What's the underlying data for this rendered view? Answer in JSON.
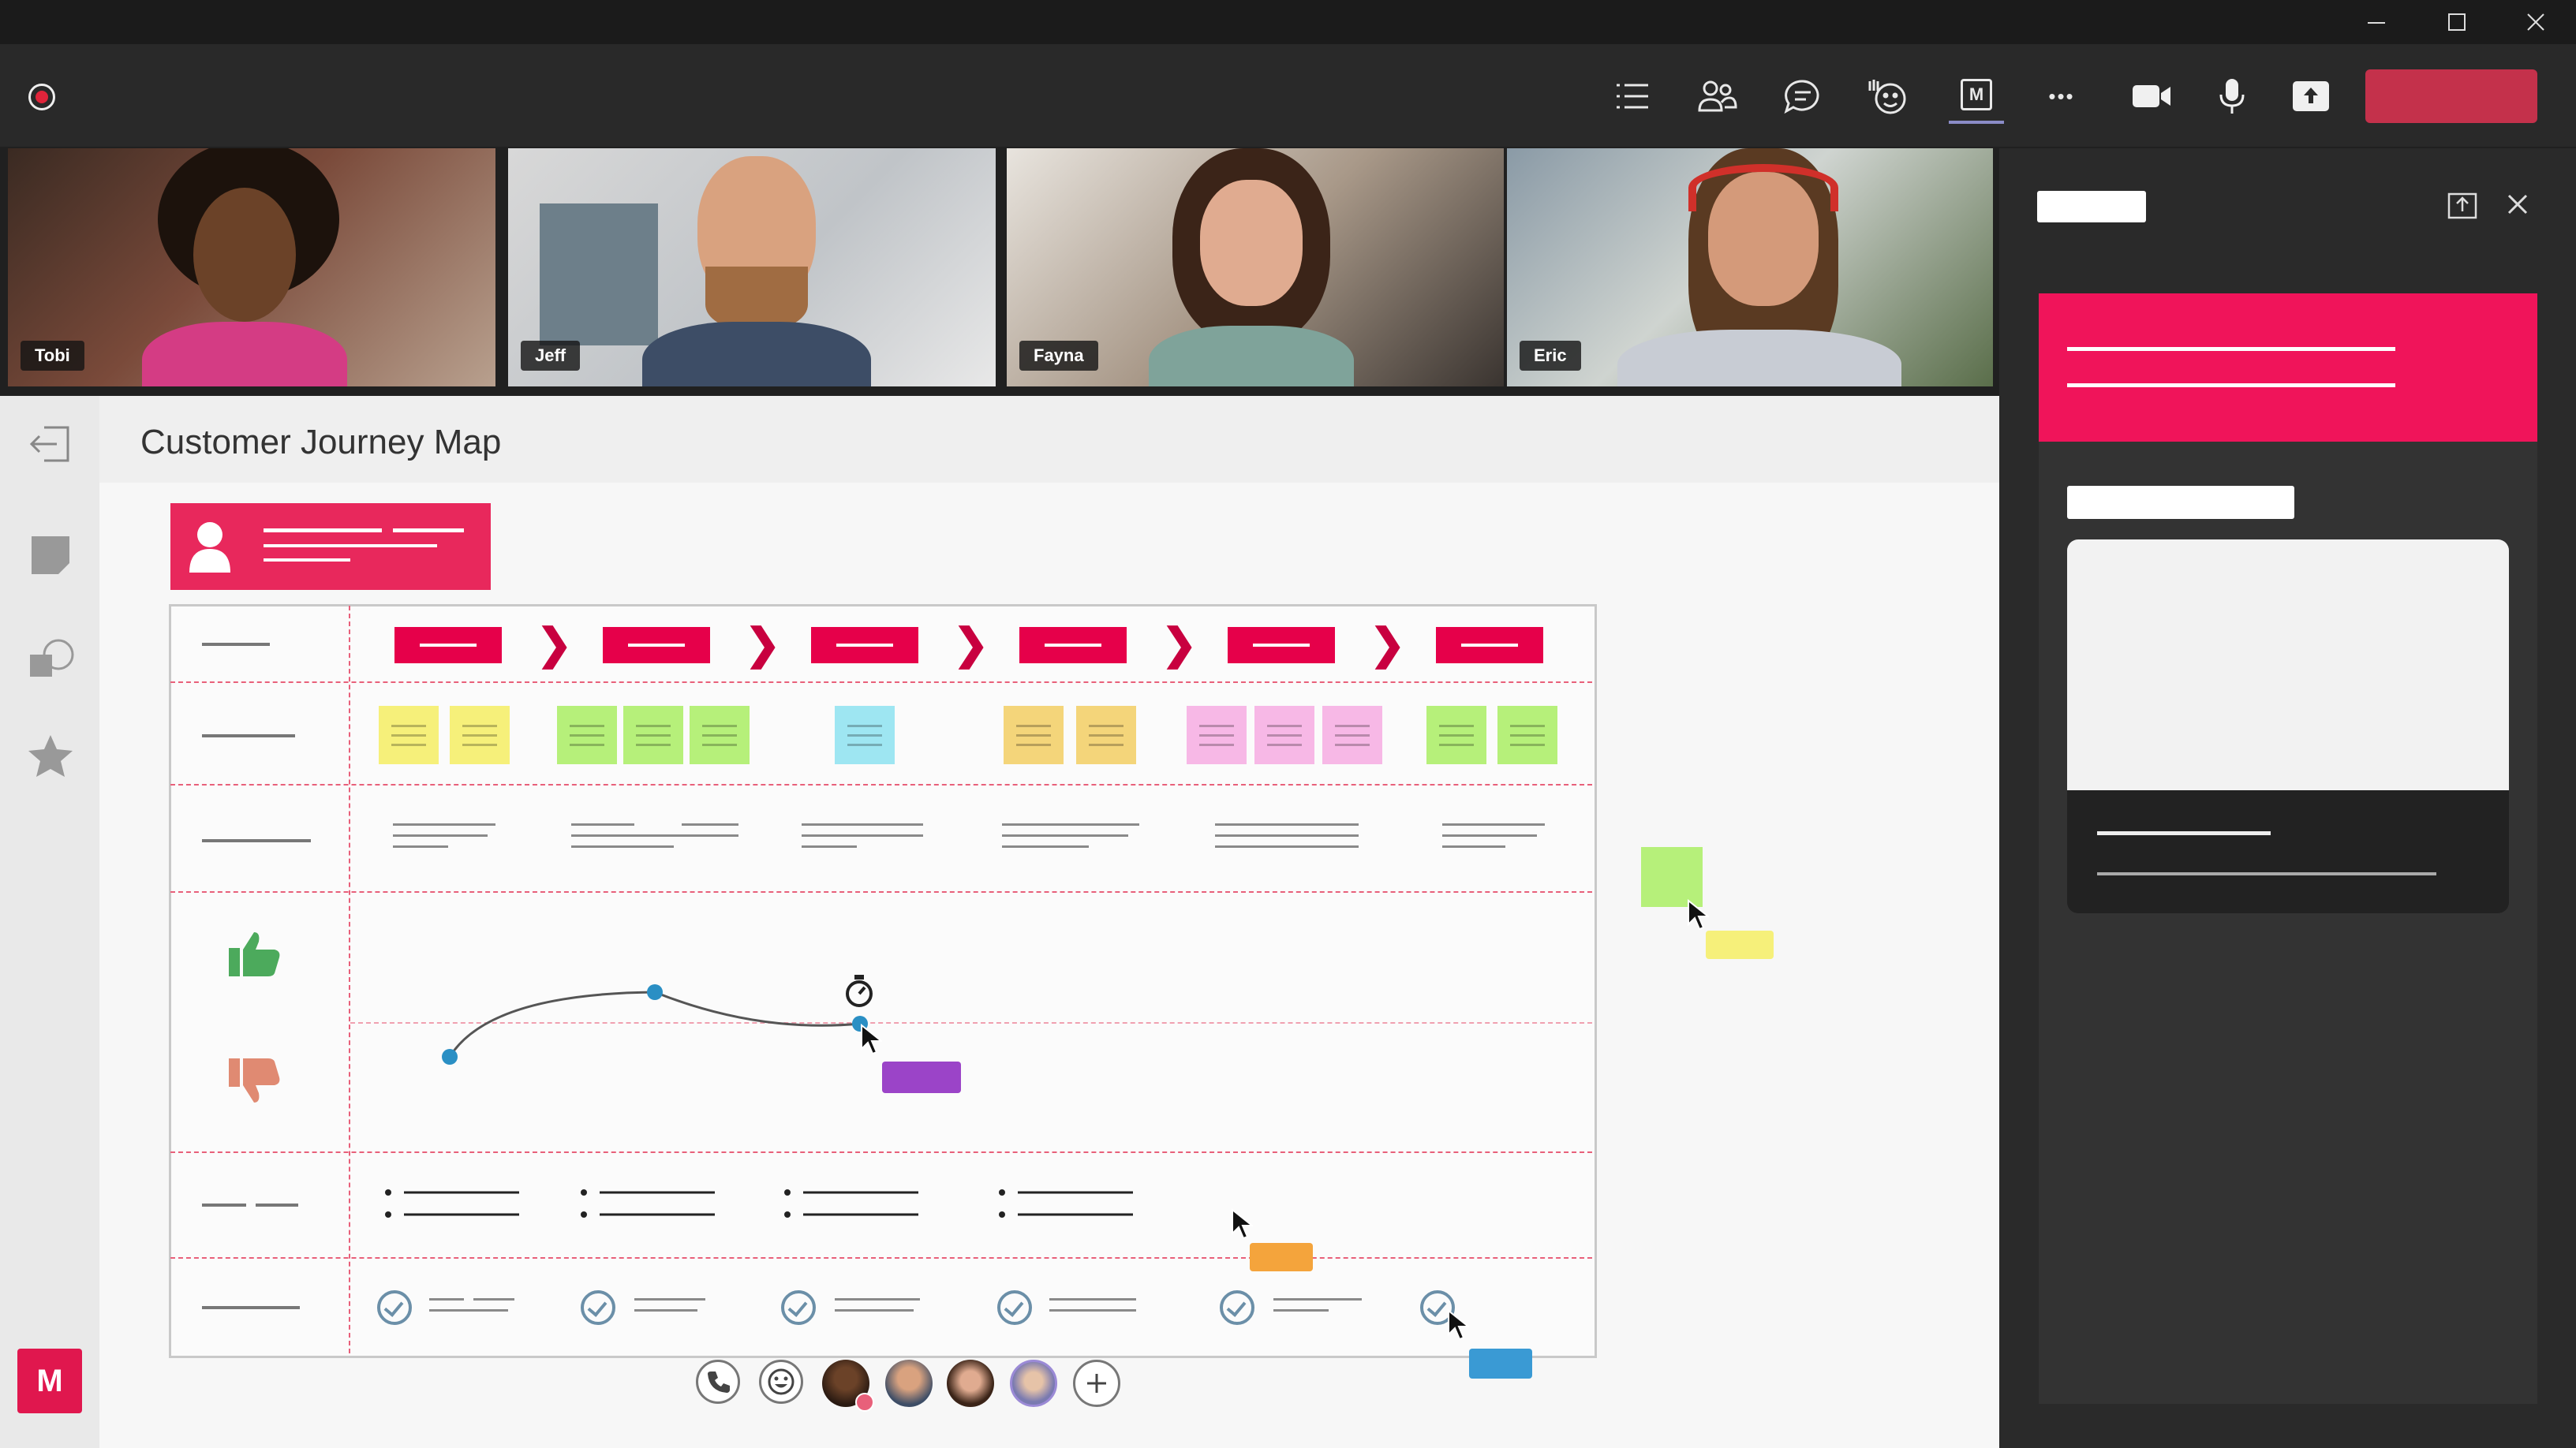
{
  "window": {
    "controls": [
      "minimize-icon",
      "maximize-icon",
      "close-icon"
    ]
  },
  "toolbar": {
    "icons": [
      "list-icon",
      "people-icon",
      "chat-icon",
      "raise-hand-icon",
      "whiteboard-app-icon",
      "more-options-icon",
      "camera-icon",
      "microphone-icon",
      "share-screen-icon"
    ],
    "whiteboard_icon_letter": "M",
    "more_label": "•••",
    "leave_button_color": "#c4314b"
  },
  "participants": [
    {
      "name": "Tobi"
    },
    {
      "name": "Jeff"
    },
    {
      "name": "Fayna"
    },
    {
      "name": "Eric"
    }
  ],
  "whiteboard": {
    "title": "Customer Journey Map",
    "left_tools": [
      "exit-icon",
      "sticky-note-icon",
      "shapes-icon",
      "favorites-icon"
    ],
    "app_logo_letter": "M",
    "accent_color": "#e6004a",
    "stage_count": 6,
    "sticky_notes": [
      {
        "stage": 1,
        "colors": [
          "#f6f07a",
          "#f6f07a"
        ]
      },
      {
        "stage": 2,
        "colors": [
          "#b6f07a",
          "#b6f07a",
          "#b6f07a"
        ]
      },
      {
        "stage": 3,
        "colors": [
          "#9ee6f2"
        ]
      },
      {
        "stage": 4,
        "colors": [
          "#f4d57a",
          "#f4d57a"
        ]
      },
      {
        "stage": 5,
        "colors": [
          "#f7b8e6",
          "#f7b8e6",
          "#f7b8e6"
        ]
      },
      {
        "stage": 6,
        "colors": [
          "#b6f07a",
          "#b6f07a"
        ]
      }
    ],
    "emotion_icons": [
      "thumbs-up-icon",
      "thumbs-down-icon"
    ],
    "bottom_bar_icons": [
      "phone-icon",
      "emoji-icon",
      "add-participant-icon"
    ]
  },
  "side_panel": {
    "icons": [
      "popout-icon",
      "close-icon"
    ],
    "header_color": "#e6004a"
  }
}
